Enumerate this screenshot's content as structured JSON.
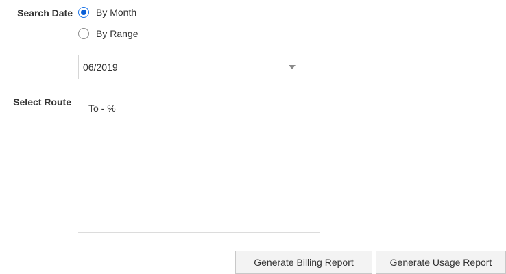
{
  "search_date": {
    "label": "Search Date",
    "options": [
      {
        "label": "By Month",
        "checked": true
      },
      {
        "label": "By Range",
        "checked": false
      }
    ],
    "month_select": {
      "value": "06/2019",
      "icon": "chevron-down-icon"
    }
  },
  "route": {
    "label": "Select Route",
    "items": [
      "To - %"
    ]
  },
  "actions": {
    "billing_label": "Generate Billing Report",
    "usage_label": "Generate Usage Report"
  },
  "colors": {
    "accent": "#0a5fd6",
    "text": "#333333",
    "button_bg": "#f3f3f3",
    "border": "#d6d6d6"
  }
}
